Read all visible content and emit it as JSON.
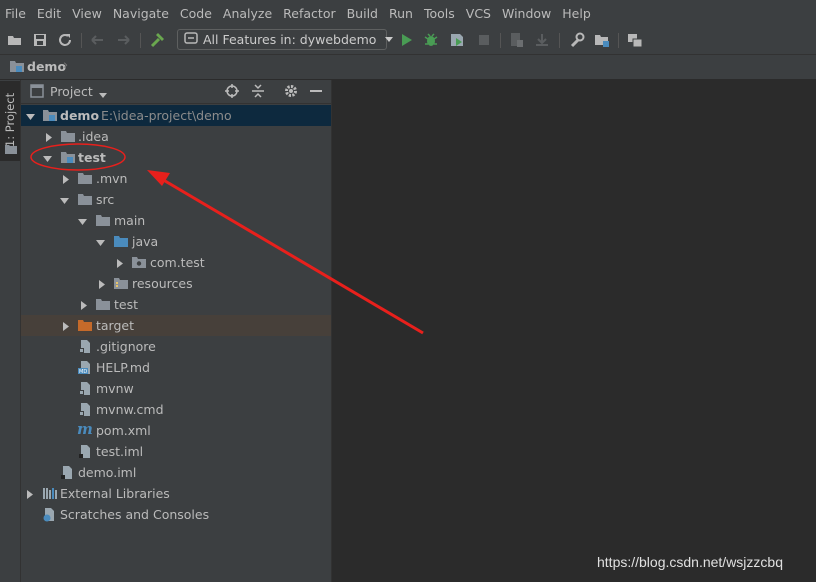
{
  "menu": [
    "File",
    "Edit",
    "View",
    "Navigate",
    "Code",
    "Analyze",
    "Refactor",
    "Build",
    "Run",
    "Tools",
    "VCS",
    "Window",
    "Help"
  ],
  "toolbar": {
    "run_config_label": "All Features in: dywebdemo",
    "icons": [
      "open-folder",
      "save",
      "sync",
      "back",
      "forward",
      "build-hammer",
      "run",
      "debug",
      "coverage",
      "stop",
      "project-structure",
      "sdk",
      "settings",
      "project-folders",
      "sdk-manager"
    ]
  },
  "navbar": {
    "project": "demo"
  },
  "side_tab": {
    "label": "1: Project"
  },
  "panel": {
    "title": "Project",
    "dropdown": "▼"
  },
  "tree": {
    "root_name": "demo",
    "root_path": "E:\\idea-project\\demo",
    "items": [
      {
        "label": ".idea"
      },
      {
        "label": "test"
      },
      {
        "label": ".mvn"
      },
      {
        "label": "src"
      },
      {
        "label": "main"
      },
      {
        "label": "java"
      },
      {
        "label": "com.test"
      },
      {
        "label": "resources"
      },
      {
        "label": "test"
      },
      {
        "label": "target"
      },
      {
        "label": ".gitignore"
      },
      {
        "label": "HELP.md"
      },
      {
        "label": "mvnw"
      },
      {
        "label": "mvnw.cmd"
      },
      {
        "label": "pom.xml"
      },
      {
        "label": "test.iml"
      },
      {
        "label": "demo.iml"
      },
      {
        "label": "External Libraries"
      },
      {
        "label": "Scratches and Consoles"
      }
    ]
  },
  "watermark": "https://blog.csdn.net/wsjzzcbq",
  "colors": {
    "background": "#2b2b2b",
    "panel": "#3c3f41",
    "selection": "#0d293e",
    "excluded_row": "#47403a",
    "annotation": "#e8201c",
    "folder": "#8a9199",
    "source_folder": "#4a8bbd",
    "target_folder": "#c56a2a"
  }
}
